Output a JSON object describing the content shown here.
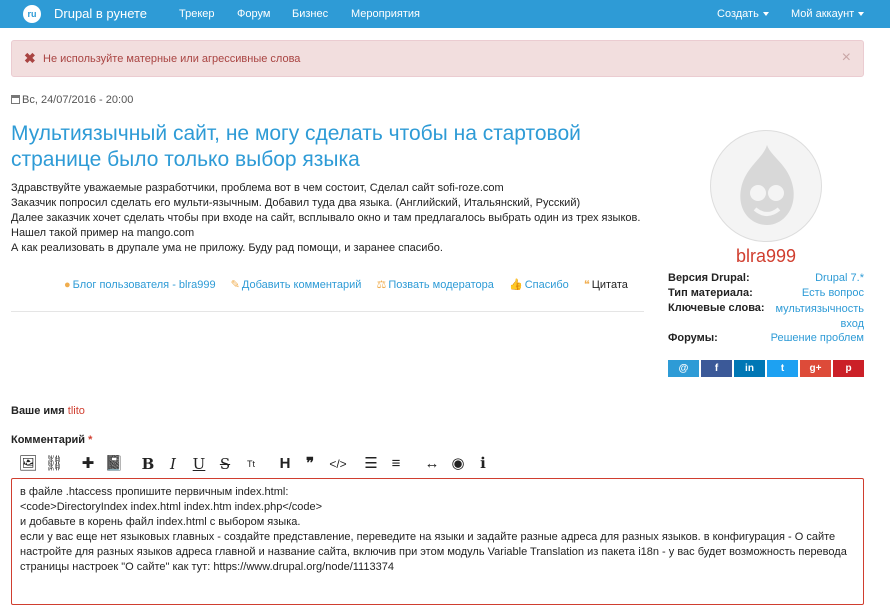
{
  "navbar": {
    "logo": "ru",
    "brand": "Drupal в рунете",
    "items": [
      "Трекер",
      "Форум",
      "Бизнес",
      "Мероприятия"
    ],
    "create": "Создать",
    "account": "Мой аккаунт"
  },
  "alert": {
    "text": "Не используйте матерные или агрессивные слова",
    "close": "×"
  },
  "post": {
    "date": "Вс, 24/07/2016 - 20:00",
    "title": "Мультиязычный сайт, не могу сделать чтобы на стартовой странице было только выбор языка",
    "body": [
      "Здравствуйте уважаемые разработчики, проблема вот в чем состоит, Сделал сайт sofi-roze.com",
      "Заказчик попросил сделать его мульти-язычным. Добавил туда два языка. (Английский, Итальянский, Русский)",
      "Далее заказчик хочет сделать чтобы при входе на сайт, всплывало окно и там предлагалось выбрать один из трех языков.",
      "Нашел такой пример на mango.com",
      "А как реализовать в друпале ума не приложу. Буду рад помощи, и заранее спасибо."
    ],
    "links": {
      "blog": "Блог пользователя - blra999",
      "add_comment": "Добавить комментарий",
      "moderator": "Позвать модератора",
      "thanks": "Спасибо",
      "quote": "Цитата"
    }
  },
  "sidebar": {
    "username": "blra999",
    "meta": [
      {
        "key": "Версия Drupal:",
        "value": "Drupal 7.*"
      },
      {
        "key": "Тип материала:",
        "value": "Есть вопрос"
      },
      {
        "key": "Ключевые слова:",
        "value": "мультиязычность вход"
      },
      {
        "key": "Форумы:",
        "value": "Решение проблем"
      }
    ],
    "share": [
      {
        "icon": "email-icon",
        "glyph": "@",
        "color": "#2e9bd6"
      },
      {
        "icon": "facebook-icon",
        "glyph": "f",
        "color": "#3b5998"
      },
      {
        "icon": "linkedin-icon",
        "glyph": "in",
        "color": "#0077b5"
      },
      {
        "icon": "twitter-icon",
        "glyph": "t",
        "color": "#1da1f2"
      },
      {
        "icon": "googleplus-icon",
        "glyph": "g+",
        "color": "#dd4b39"
      },
      {
        "icon": "pinterest-icon",
        "glyph": "p",
        "color": "#cb2027"
      }
    ]
  },
  "form": {
    "name_label": "Ваше имя",
    "name_value": "tlito",
    "comment_label": "Комментарий",
    "required_mark": "*",
    "editor_lines": [
      "в файле .htaccess пропишите первичным index.html:",
      "<code>DirectoryIndex index.html index.htm index.php</code>",
      "и добавьте в корень файл index.html с выбором языка.",
      "если у вас еще нет языковых главных - создайте представление, переведите на языки и задайте разные адреса для разных языков. в конфигурация - О сайте настройте для разных языков адреса главной и название сайта, включив при этом модуль Variable Translation из пакета i18n - у вас будет возможность перевода страницы настроек \"О сайте\" как тут: https://www.drupal.org/node/1113374"
    ]
  },
  "toolbar": [
    {
      "name": "image-icon",
      "glyph": "🖼"
    },
    {
      "name": "link-icon",
      "glyph": "⛓"
    },
    {
      "name": "plugin-icon",
      "glyph": "✚"
    },
    {
      "name": "book-icon",
      "glyph": "📓"
    },
    {
      "name": "bold-icon",
      "glyph": "B"
    },
    {
      "name": "italic-icon",
      "glyph": "I"
    },
    {
      "name": "underline-icon",
      "glyph": "U"
    },
    {
      "name": "strikethrough-icon",
      "glyph": "S"
    },
    {
      "name": "superscript-icon",
      "glyph": "Tt"
    },
    {
      "name": "header-icon",
      "glyph": "H"
    },
    {
      "name": "quote-icon",
      "glyph": "❞"
    },
    {
      "name": "code-icon",
      "glyph": "</>"
    },
    {
      "name": "ordered-list-icon",
      "glyph": "☰"
    },
    {
      "name": "unordered-list-icon",
      "glyph": "≡"
    },
    {
      "name": "horizontal-rule-icon",
      "glyph": "↔"
    },
    {
      "name": "preview-icon",
      "glyph": "◉"
    },
    {
      "name": "info-icon",
      "glyph": "ℹ"
    }
  ]
}
